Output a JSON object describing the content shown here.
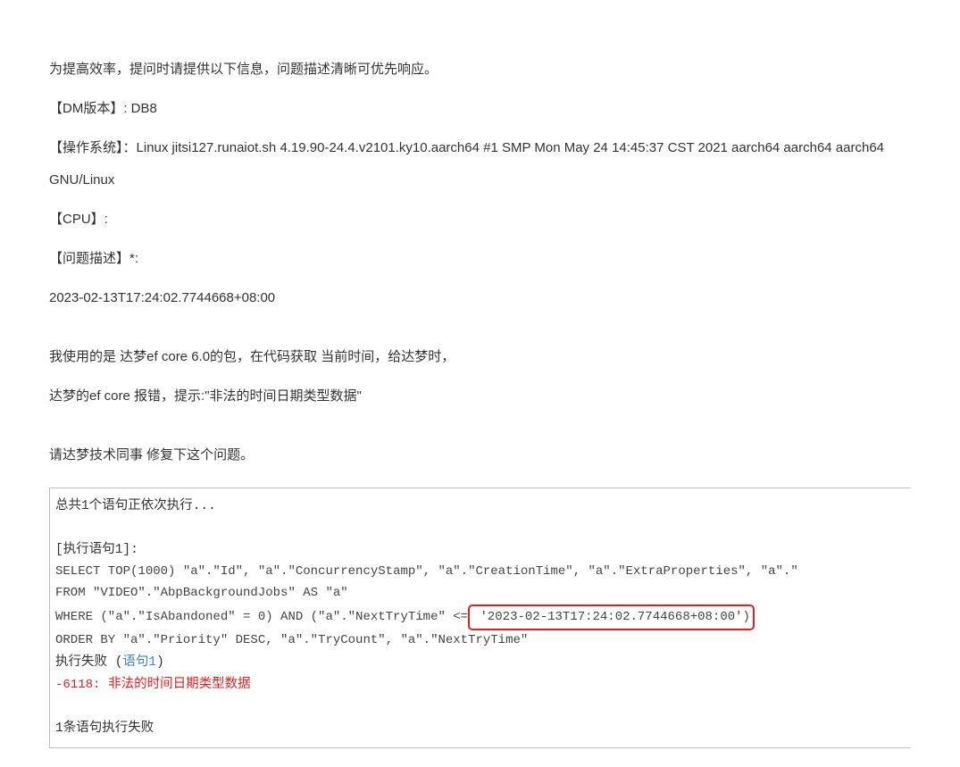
{
  "intro": "为提高效率，提问时请提供以下信息，问题描述清晰可优先响应。",
  "dm_version_label": "【DM版本】",
  "dm_version_value": ": DB8",
  "os_label": "【操作系统】",
  "os_value": "：Linux jitsi127.runaiot.sh 4.19.90-24.4.v2101.ky10.aarch64 #1 SMP Mon May 24 14:45:37 CST 2021 aarch64 aarch64 aarch64 GNU/Linux",
  "cpu_label": "【CPU】",
  "cpu_value": ":",
  "problem_label": "【问题描述】",
  "problem_suffix": "*:",
  "timestamp": "2023-02-13T17:24:02.7744668+08:00",
  "desc_line1": "我使用的是 达梦ef core 6.0的包，在代码获取 当前时间，给达梦时，",
  "desc_line2": "达梦的ef core 报错，提示:\"非法的时间日期类型数据\"",
  "desc_line3": "请达梦技术同事 修复下这个问题。",
  "code": {
    "header": "总共1个语句正依次执行...",
    "exec_label": "[执行语句1]:",
    "sql1": "SELECT TOP(1000) \"a\".\"Id\", \"a\".\"ConcurrencyStamp\", \"a\".\"CreationTime\", \"a\".\"ExtraProperties\", \"a\".\"",
    "sql2": "FROM \"VIDEO\".\"AbpBackgroundJobs\" AS \"a\"",
    "sql3_before": "WHERE (\"a\".\"IsAbandoned\" = 0) AND (\"a\".\"NextTryTime\" <=",
    "sql3_highlight": " '2023-02-13T17:24:02.7744668+08:00')",
    "sql4": "ORDER BY \"a\".\"Priority\" DESC, \"a\".\"TryCount\", \"a\".\"NextTryTime\"",
    "fail_prefix": "执行失败 (",
    "fail_link": "语句1",
    "fail_suffix": ")",
    "error_code": "-6118:",
    "error_msg": " 非法的时间日期类型数据",
    "footer": "1条语句执行失败"
  }
}
